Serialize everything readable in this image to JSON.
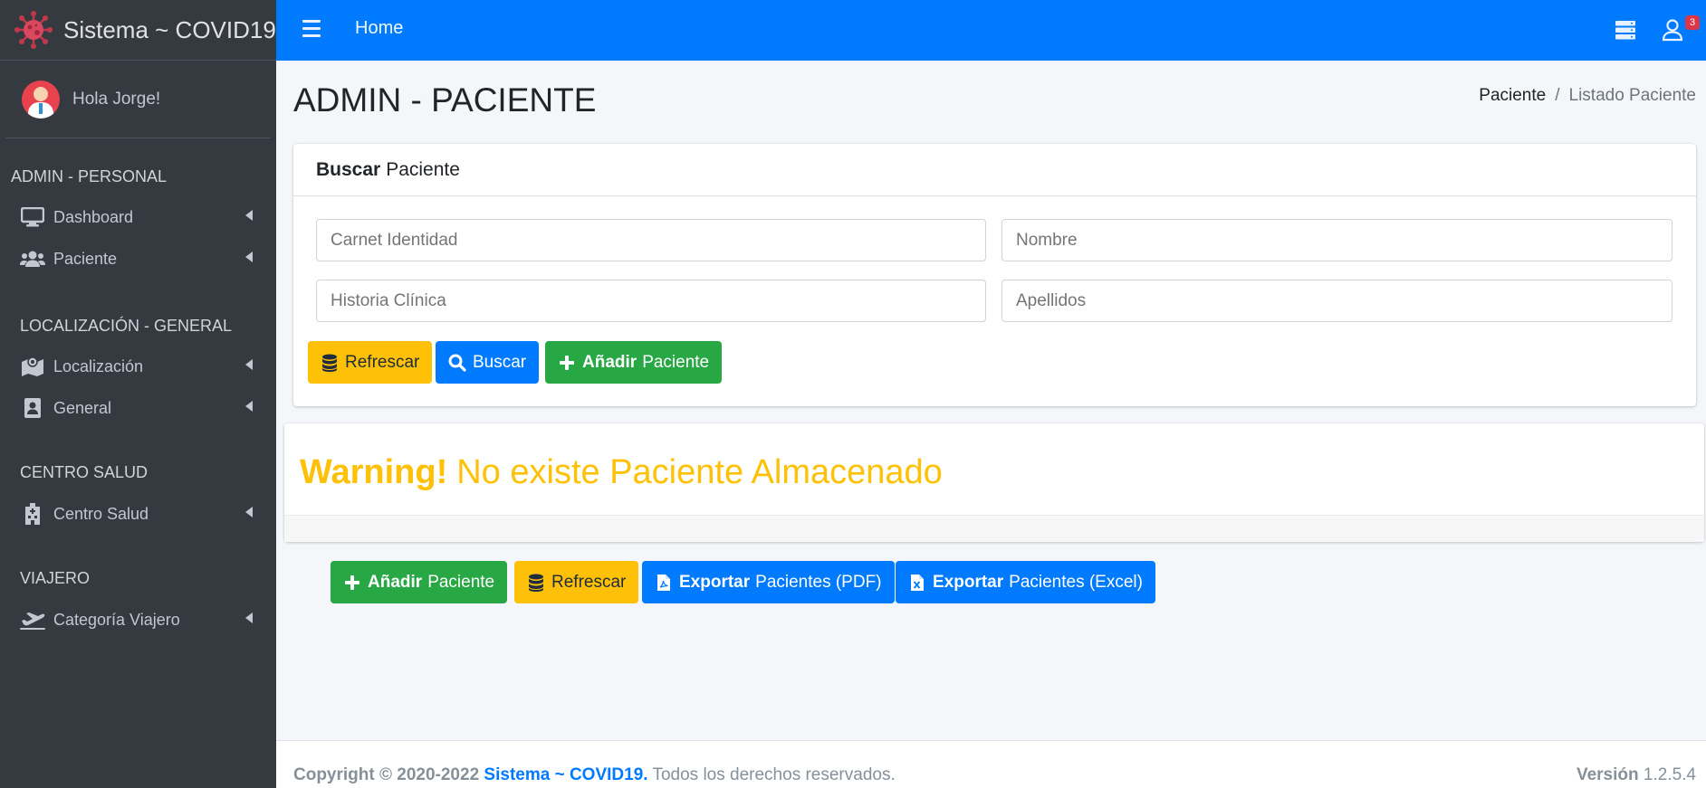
{
  "brand": {
    "title": "Sistema ~ COVID19"
  },
  "user": {
    "greeting": "Hola Jorge!"
  },
  "sidebar": {
    "sections": [
      {
        "header": "ADMIN - PERSONAL",
        "items": [
          {
            "label": "Dashboard",
            "icon": "desktop-icon"
          },
          {
            "label": "Paciente",
            "icon": "users-icon"
          }
        ]
      },
      {
        "header": "LOCALIZACIÓN - GENERAL",
        "items": [
          {
            "label": "Localización",
            "icon": "map-icon"
          },
          {
            "label": "General",
            "icon": "contact-card-icon"
          }
        ]
      },
      {
        "header": "CENTRO SALUD",
        "items": [
          {
            "label": "Centro Salud",
            "icon": "hospital-icon"
          }
        ]
      },
      {
        "header": "VIAJERO",
        "items": [
          {
            "label": "Categoría Viajero",
            "icon": "plane-departure-icon"
          }
        ]
      }
    ]
  },
  "navbar": {
    "home": "Home",
    "notifications_count": "3"
  },
  "header": {
    "title": "ADMIN - PACIENTE",
    "breadcrumb": [
      "Paciente",
      "Listado Paciente"
    ]
  },
  "search": {
    "title_bold": "Buscar",
    "title_rest": "Paciente",
    "fields": {
      "ci_placeholder": "Carnet Identidad",
      "nombre_placeholder": "Nombre",
      "historia_placeholder": "Historia Clínica",
      "apellidos_placeholder": "Apellidos"
    },
    "buttons": {
      "refresh": "Refrescar",
      "search": "Buscar",
      "add_bold": "Añadir",
      "add_rest": "Paciente"
    }
  },
  "alert": {
    "bold": "Warning!",
    "message": "No existe Paciente Almacenado"
  },
  "actions": {
    "add_bold": "Añadir",
    "add_rest": "Paciente",
    "refresh": "Refrescar",
    "pdf_bold": "Exportar",
    "pdf_rest": "Pacientes (PDF)",
    "excel_bold": "Exportar",
    "excel_rest": "Pacientes (Excel)"
  },
  "footer": {
    "copyright_prefix": "Copyright © 2020-2022",
    "brand": "Sistema ~ COVID19.",
    "rights": "Todos los derechos reservados.",
    "version_label": "Versión",
    "version": "1.2.5.4"
  },
  "colors": {
    "primary": "#007bff",
    "warning": "#ffc107",
    "success": "#28a745",
    "sidebar": "#343a40",
    "danger": "#dc3545"
  }
}
